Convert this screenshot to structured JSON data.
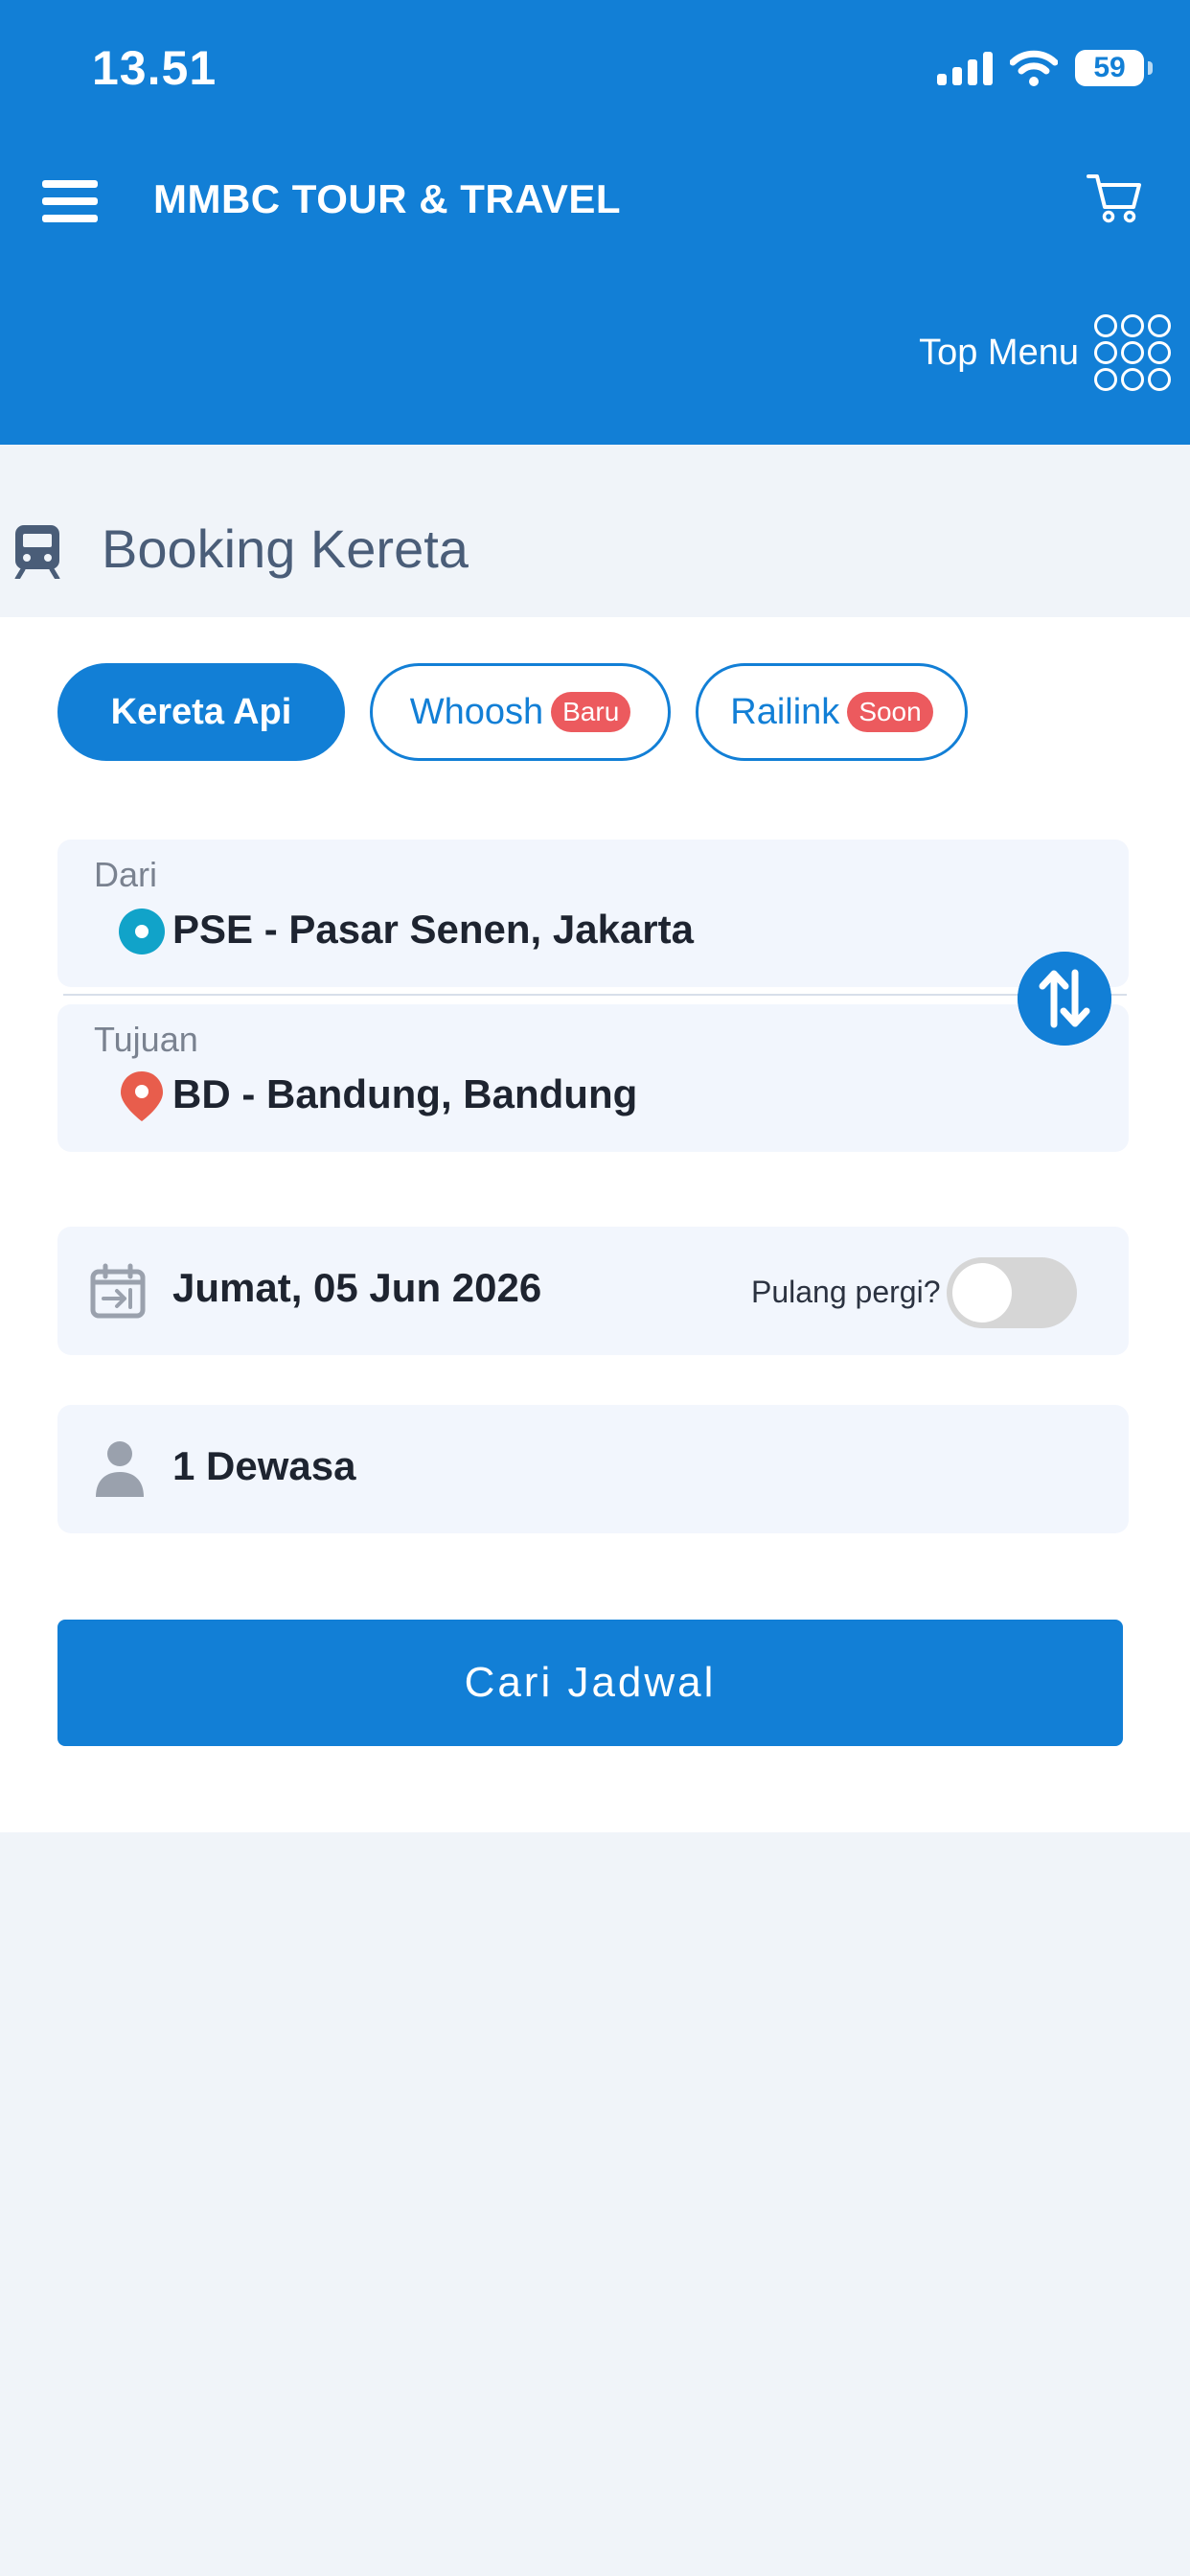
{
  "status_bar": {
    "time": "13.51",
    "battery": "59"
  },
  "header": {
    "title": "MMBC TOUR & TRAVEL",
    "top_menu_label": "Top Menu"
  },
  "section": {
    "title": "Booking Kereta"
  },
  "tabs": [
    {
      "label": "Kereta Api",
      "active": true,
      "badge": ""
    },
    {
      "label": "Whoosh",
      "active": false,
      "badge": "Baru"
    },
    {
      "label": "Railink",
      "active": false,
      "badge": "Soon"
    }
  ],
  "form": {
    "origin": {
      "label": "Dari",
      "value": "PSE - Pasar Senen, Jakarta"
    },
    "destination": {
      "label": "Tujuan",
      "value": "BD - Bandung, Bandung"
    },
    "date": {
      "value": "Jumat, 05 Jun 2026"
    },
    "round_trip": {
      "label": "Pulang pergi?",
      "enabled": false
    },
    "passengers": {
      "value": "1 Dewasa"
    },
    "search_button": "Cari Jadwal"
  },
  "icons": {
    "menu": "hamburger-icon",
    "cart": "cart-icon",
    "top_menu": "grid-icon",
    "train": "train-icon",
    "origin": "origin-dot-icon",
    "destination": "location-pin-icon",
    "swap": "swap-icon",
    "calendar": "calendar-icon",
    "person": "person-icon"
  },
  "colors": {
    "primary": "#127fd6",
    "badge": "#ec5a5e",
    "origin_dot": "#11a3c9",
    "destination_pin": "#e85d4c",
    "field_bg": "#f2f6fd",
    "page_bg": "#f0f4f9"
  }
}
